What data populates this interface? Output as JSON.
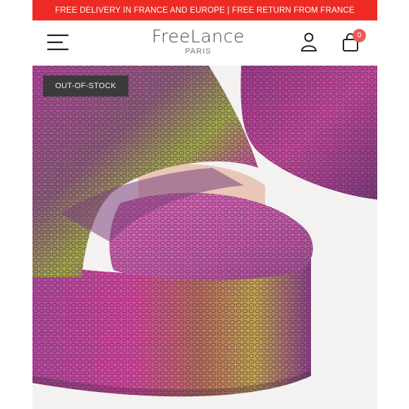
{
  "promo": {
    "text": "FREE DELIVERY IN FRANCE AND EUROPE | FREE RETURN FROM FRANCE"
  },
  "header": {
    "brand": "FreeLance",
    "brand_sub": "PARIS",
    "cart_count": "0"
  },
  "icons": {
    "menu": "hamburger-menu-icon",
    "account": "user-icon",
    "cart": "shopping-bag-icon"
  },
  "product": {
    "badge": "OUT-OF-STOCK",
    "image": "snake-print platform sandal"
  },
  "colors": {
    "promo_bar": "#ee2a24",
    "badge_bg": "#3b3b3b",
    "cart_badge": "#ee5a5a"
  }
}
